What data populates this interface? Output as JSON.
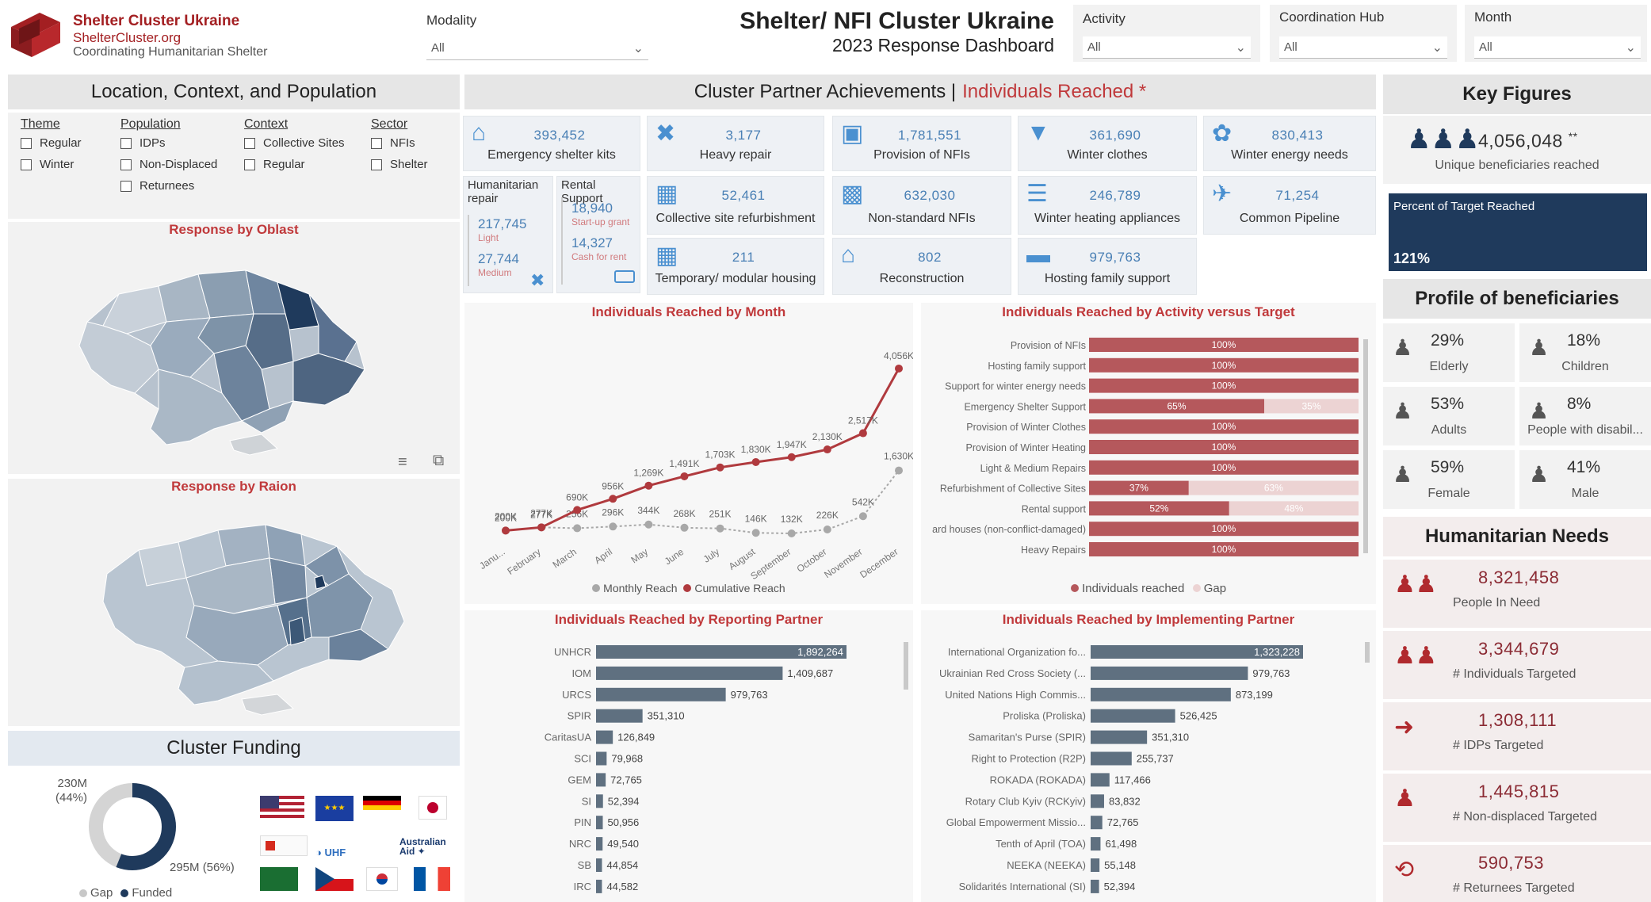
{
  "header": {
    "org_name": "Shelter Cluster Ukraine",
    "org_url": "ShelterCluster.org",
    "org_sub": "Coordinating Humanitarian Shelter",
    "title": "Shelter/ NFI Cluster Ukraine",
    "subtitle": "2023 Response Dashboard",
    "filters": {
      "modality": {
        "label": "Modality",
        "value": "All"
      },
      "activity": {
        "label": "Activity",
        "value": "All"
      },
      "hub": {
        "label": "Coordination Hub",
        "value": "All"
      },
      "month": {
        "label": "Month",
        "value": "All"
      }
    }
  },
  "location": {
    "title": "Location, Context, and Population",
    "theme": {
      "title": "Theme",
      "options": [
        "Regular",
        "Winter"
      ]
    },
    "population": {
      "title": "Population",
      "options": [
        "IDPs",
        "Non-Displaced",
        "Returnees"
      ]
    },
    "context": {
      "title": "Context",
      "options": [
        "Collective Sites",
        "Regular"
      ]
    },
    "sector": {
      "title": "Sector",
      "options": [
        "NFIs",
        "Shelter"
      ]
    },
    "map_oblast_title": "Response by Oblast",
    "map_raion_title": "Response by Raion"
  },
  "funding": {
    "title": "Cluster Funding",
    "gap_label": "230M\n(44%)",
    "gap_value": "230M",
    "gap_pct": "(44%)",
    "funded_label": "295M (56%)",
    "legend_gap": "Gap",
    "legend_funded": "Funded",
    "funded_fraction": 0.56
  },
  "achievements": {
    "title": "Cluster Partner Achievements |",
    "title_red": "Individuals Reached *",
    "cards": [
      {
        "value": "393,452",
        "label": "Emergency shelter kits",
        "icon": "tent-icon"
      },
      {
        "value": "3,177",
        "label": "Heavy repair",
        "icon": "tools-icon"
      },
      {
        "value": "1,781,551",
        "label": "Provision of NFIs",
        "icon": "nfi-icon"
      },
      {
        "value": "361,690",
        "label": "Winter clothes",
        "icon": "shirt-icon"
      },
      {
        "value": "830,413",
        "label": "Winter energy needs",
        "icon": "flame-icon"
      },
      {
        "value": "52,461",
        "label": "Collective site refurbishment",
        "icon": "building-icon"
      },
      {
        "value": "632,030",
        "label": "Non-standard NFIs",
        "icon": "truck-nfi-icon"
      },
      {
        "value": "246,789",
        "label": "Winter heating appliances",
        "icon": "heater-icon"
      },
      {
        "value": "71,254",
        "label": "Common Pipeline",
        "icon": "truck-icon"
      },
      {
        "value": "211",
        "label": "Temporary/ modular housing",
        "icon": "modular-icon"
      },
      {
        "value": "802",
        "label": "Reconstruction",
        "icon": "reconstruction-icon"
      },
      {
        "value": "979,763",
        "label": "Hosting family support",
        "icon": "sofa-icon"
      }
    ],
    "humanitarian_repair": {
      "title": "Humanitarian repair",
      "light_value": "217,745",
      "light_label": "Light",
      "medium_value": "27,744",
      "medium_label": "Medium"
    },
    "rental_support": {
      "title": "Rental Support",
      "startup_value": "18,940",
      "startup_label": "Start-up grant",
      "cash_value": "14,327",
      "cash_label": "Cash for rent"
    }
  },
  "key_figures": {
    "title": "Key Figures",
    "unique_value": "4,056,048",
    "unique_mark": "**",
    "unique_label": "Unique beneficiaries reached",
    "target_label": "Percent of Target Reached",
    "target_value": "121%"
  },
  "profile": {
    "title": "Profile of beneficiaries",
    "items": [
      {
        "pct": "29%",
        "label": "Elderly"
      },
      {
        "pct": "18%",
        "label": "Children"
      },
      {
        "pct": "53%",
        "label": "Adults"
      },
      {
        "pct": "8%",
        "label": "People with disabil..."
      },
      {
        "pct": "59%",
        "label": "Female"
      },
      {
        "pct": "41%",
        "label": "Male"
      }
    ]
  },
  "needs": {
    "title": "Humanitarian Needs",
    "items": [
      {
        "value": "8,321,458",
        "label": "People In Need"
      },
      {
        "value": "3,344,679",
        "label": "# Individuals Targeted"
      },
      {
        "value": "1,308,111",
        "label": "# IDPs Targeted"
      },
      {
        "value": "1,445,815",
        "label": "# Non-displaced Targeted"
      },
      {
        "value": "590,753",
        "label": "# Returnees Targeted"
      }
    ]
  },
  "chart_data": [
    {
      "type": "line",
      "title": "Individuals Reached by Month",
      "categories": [
        "Janu...",
        "February",
        "March",
        "April",
        "May",
        "June",
        "July",
        "August",
        "September",
        "October",
        "November",
        "December"
      ],
      "series": [
        {
          "name": "Monthly Reach",
          "values": [
            200000,
            277000,
            256000,
            296000,
            344000,
            268000,
            251000,
            146000,
            132000,
            226000,
            542000,
            1630000
          ],
          "labels": [
            "200K",
            "277K",
            "256K",
            "296K",
            "344K",
            "268K",
            "251K",
            "146K",
            "132K",
            "226K",
            "542K",
            "1,630K"
          ],
          "color": "#a8a8a8"
        },
        {
          "name": "Cumulative Reach",
          "values": [
            200000,
            277000,
            690000,
            956000,
            1269000,
            1491000,
            1703000,
            1830000,
            1947000,
            2130000,
            2517000,
            4056000
          ],
          "labels": [
            "200K",
            "277K",
            "690K",
            "956K",
            "1,269K",
            "1,491K",
            "1,703K",
            "1,830K",
            "1,947K",
            "2,130K",
            "2,517K",
            "4,056K"
          ],
          "color": "#b03a3e"
        }
      ],
      "legend": [
        "Monthly Reach",
        "Cumulative Reach"
      ],
      "ylim": [
        0,
        4300000
      ]
    },
    {
      "type": "bar",
      "title": "Individuals Reached by Activity versus Target",
      "categories": [
        "Provision of NFIs",
        "Hosting family support",
        "Support for winter energy needs",
        "Emergency Shelter Support",
        "Provision of Winter Clothes",
        "Provision of Winter Heating",
        "Light & Medium Repairs",
        "Refurbishment of Collective Sites",
        "Rental support",
        "ard houses (non-conflict-damaged)",
        "Heavy Repairs"
      ],
      "series": [
        {
          "name": "Individuals reached",
          "values": [
            100,
            100,
            100,
            65,
            100,
            100,
            100,
            37,
            52,
            100,
            100
          ],
          "labels": [
            "100%",
            "100%",
            "100%",
            "65%",
            "100%",
            "100%",
            "100%",
            "37%",
            "52%",
            "100%",
            "100%"
          ],
          "color": "#b5585c"
        },
        {
          "name": "Gap",
          "values": [
            0,
            0,
            0,
            35,
            0,
            0,
            0,
            63,
            48,
            0,
            0
          ],
          "labels": [
            "",
            "",
            "",
            "35%",
            "",
            "",
            "",
            "63%",
            "48%",
            "",
            ""
          ],
          "color": "#ecd3d3"
        }
      ],
      "legend": [
        "Individuals reached",
        "Gap"
      ]
    },
    {
      "type": "bar",
      "title": "Individuals Reached by Reporting Partner",
      "categories": [
        "UNHCR",
        "IOM",
        "URCS",
        "SPIR",
        "CaritasUA",
        "SCI",
        "GEM",
        "SI",
        "PIN",
        "NRC",
        "SB",
        "IRC"
      ],
      "values": [
        1892264,
        1409687,
        979763,
        351310,
        126849,
        79968,
        72765,
        52394,
        50956,
        49540,
        44854,
        44582
      ],
      "labels": [
        "1,892,264",
        "1,409,687",
        "979,763",
        "351,310",
        "126,849",
        "79,968",
        "72,765",
        "52,394",
        "50,956",
        "49,540",
        "44,854",
        "44,582"
      ],
      "color": "#5f7080"
    },
    {
      "type": "bar",
      "title": "Individuals Reached by Implementing Partner",
      "categories": [
        "International Organization fo...",
        "Ukrainian Red Cross Society (...",
        "United Nations High Commis...",
        "Proliska (Proliska)",
        "Samaritan's Purse (SPIR)",
        "Right to Protection (R2P)",
        "ROKADA (ROKADA)",
        "Rotary Club Kyiv (RCKyiv)",
        "Global Empowerment Missio...",
        "Tenth of April (TOA)",
        "NEEKA (NEEKA)",
        "Solidarités International (SI)"
      ],
      "values": [
        1323228,
        979763,
        873199,
        526425,
        351310,
        255737,
        117466,
        83832,
        72765,
        61498,
        55148,
        52394
      ],
      "labels": [
        "1,323,228",
        "979,763",
        "873,199",
        "526,425",
        "351,310",
        "255,737",
        "117,466",
        "83,832",
        "72,765",
        "61,498",
        "55,148",
        "52,394"
      ],
      "color": "#5f7080"
    }
  ]
}
